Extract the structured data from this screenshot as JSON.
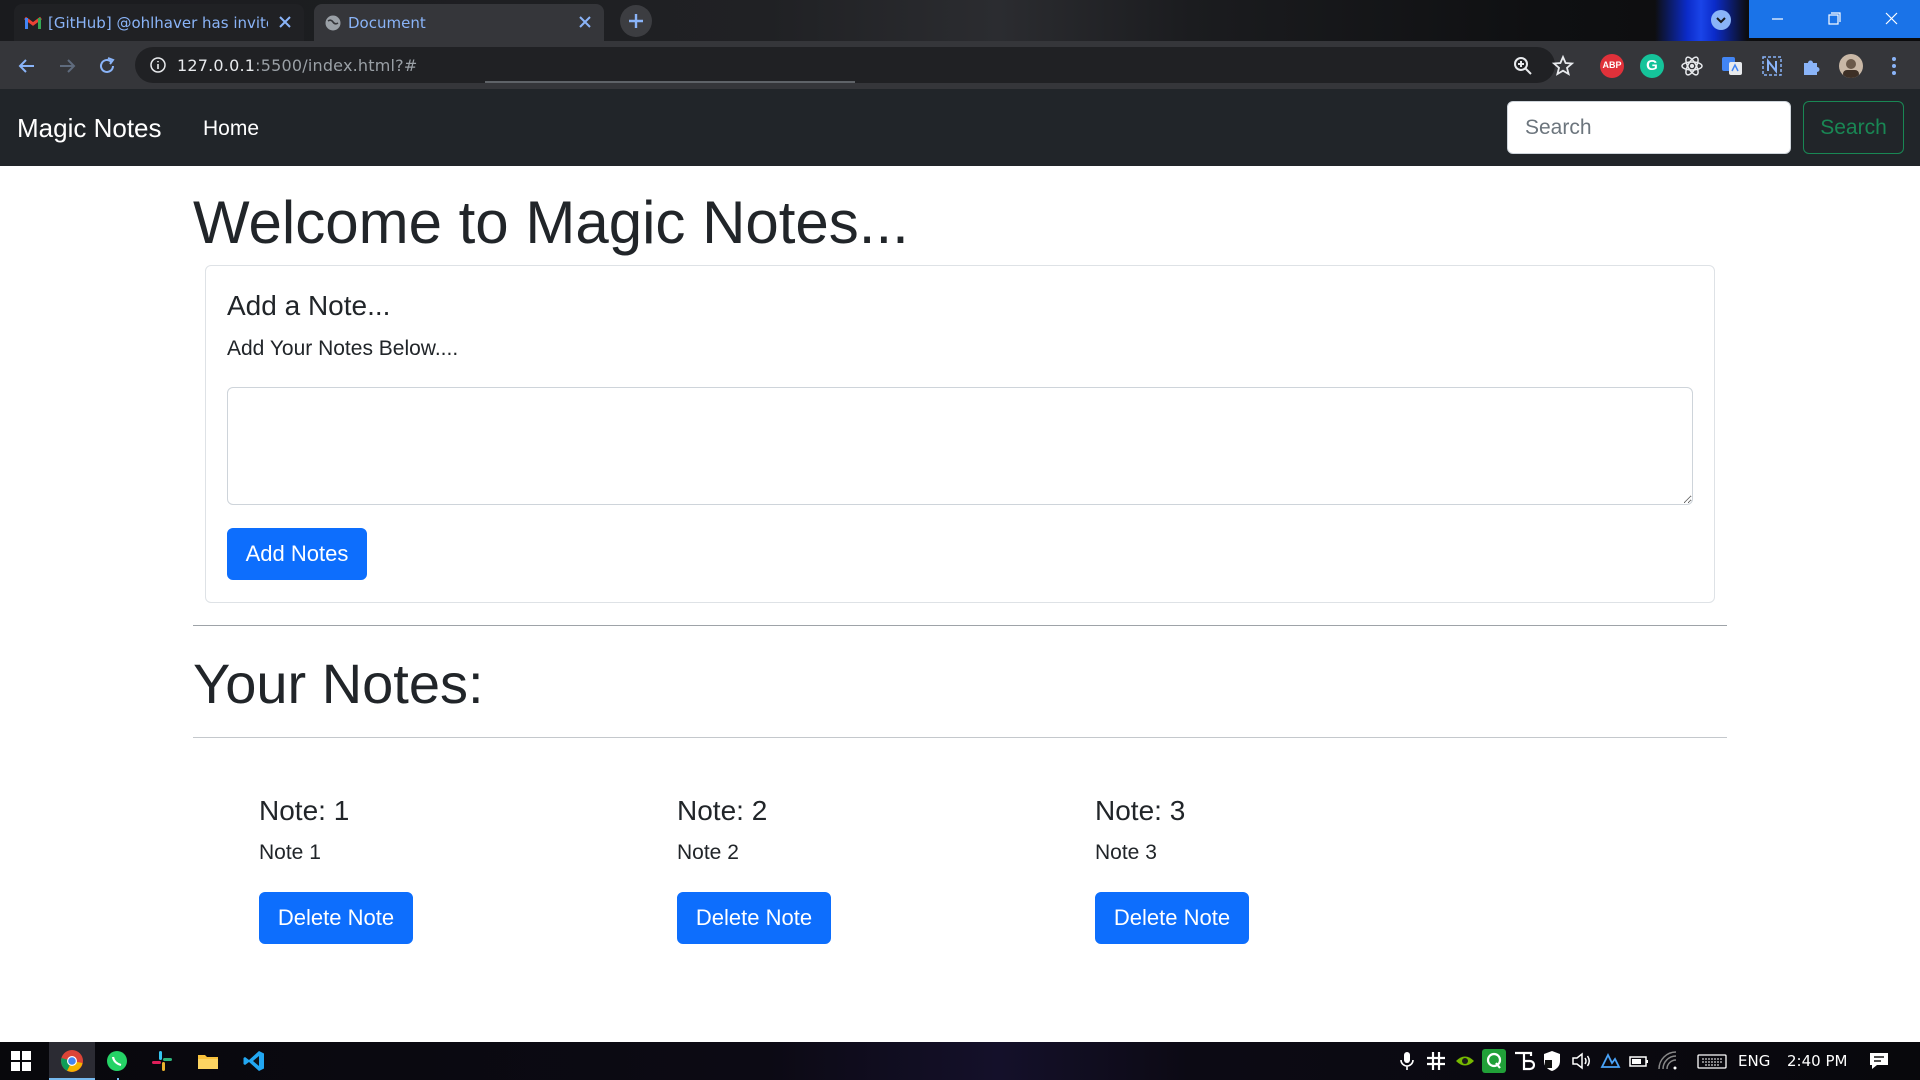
{
  "browser": {
    "tabs": [
      {
        "title": "[GitHub] @ohlhaver has invited you",
        "icon": "gmail-icon",
        "active": false
      },
      {
        "title": "Document",
        "icon": "globe-icon",
        "active": true
      }
    ],
    "url_host": "127.0.0.1",
    "url_path": ":5500/index.html?#",
    "extensions": [
      "zoom-icon",
      "star-icon",
      "adblock-icon",
      "grammarly-icon",
      "react-devtools-icon",
      "google-translate-icon",
      "notion-icon",
      "extensions-puzzle-icon",
      "profile-avatar",
      "menu-dots-icon"
    ],
    "adblock_label": "ABP",
    "grammarly_label": "G"
  },
  "navbar": {
    "brand": "Magic Notes",
    "home_link": "Home",
    "search_placeholder": "Search",
    "search_button": "Search"
  },
  "main": {
    "heading": "Welcome to Magic Notes...",
    "card": {
      "title": "Add a Note...",
      "subtitle": "Add Your Notes Below....",
      "textarea_value": "",
      "add_button": "Add Notes"
    },
    "notes_heading": "Your Notes:",
    "notes": [
      {
        "title": "Note: 1",
        "text": "Note 1",
        "delete_label": "Delete Note"
      },
      {
        "title": "Note: 2",
        "text": "Note 2",
        "delete_label": "Delete Note"
      },
      {
        "title": "Note: 3",
        "text": "Note 3",
        "delete_label": "Delete Note"
      }
    ]
  },
  "taskbar": {
    "apps": [
      "windows-start-icon",
      "chrome-icon",
      "whatsapp-icon",
      "slack-icon",
      "file-explorer-icon",
      "vscode-icon"
    ],
    "tray_language": "ENG",
    "tray_time": "2:40 PM"
  },
  "colors": {
    "navbar_bg": "#212529",
    "primary": "#0d6efd",
    "success": "#198754",
    "chrome_toolbar": "#35363a",
    "chrome_link": "#8ab4f8"
  }
}
